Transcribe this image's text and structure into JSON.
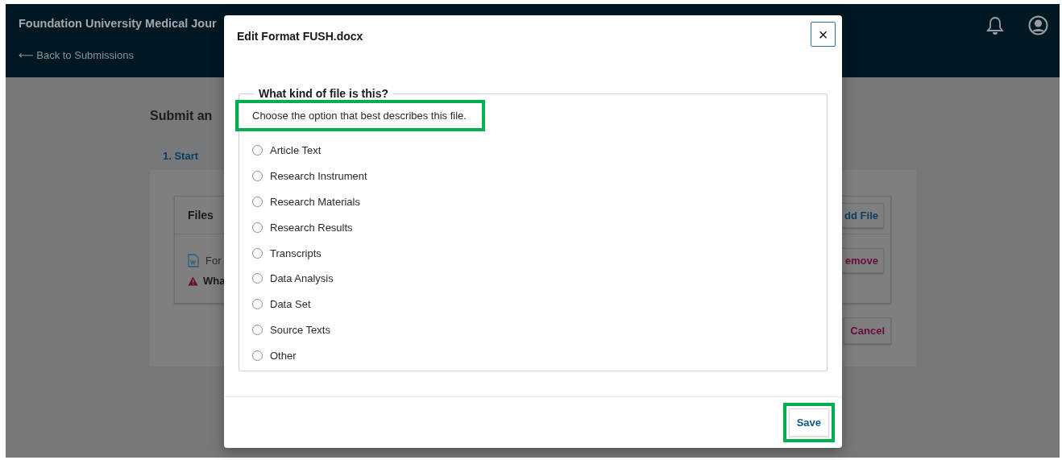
{
  "header": {
    "title": "Foundation University Medical Jour",
    "back_link": "⟵ Back to Submissions"
  },
  "page": {
    "heading": "Submit an",
    "tabs": [
      {
        "label": "1. Start",
        "selected": true
      }
    ],
    "files_panel": {
      "title": "Files",
      "add_button": "dd File",
      "file": {
        "name": "For",
        "remove_button": "emove"
      },
      "warning": "Wha"
    },
    "cancel_button": "Cancel"
  },
  "modal": {
    "title": "Edit Format FUSH.docx",
    "close": "×",
    "fieldset": {
      "legend": "What kind of file is this?",
      "description": {
        "text": "Choose the option that best describes this file.",
        "highlighted": true
      },
      "options": [
        {
          "label": "Article Text",
          "selected": false,
          "focused": false
        },
        {
          "label": "Research Instrument",
          "selected": false,
          "focused": false
        },
        {
          "label": "Research Materials",
          "selected": false,
          "focused": false
        },
        {
          "label": "Research Results",
          "selected": false,
          "focused": false
        },
        {
          "label": "Transcripts",
          "selected": false,
          "focused": false
        },
        {
          "label": "Data Analysis",
          "selected": false,
          "focused": false
        },
        {
          "label": "Data Set",
          "selected": false,
          "focused": false
        },
        {
          "label": "Source Texts",
          "selected": false,
          "focused": false
        },
        {
          "label": "Other",
          "selected": false,
          "focused": false
        }
      ]
    },
    "save_button": {
      "label": "Save",
      "highlighted": true
    }
  }
}
